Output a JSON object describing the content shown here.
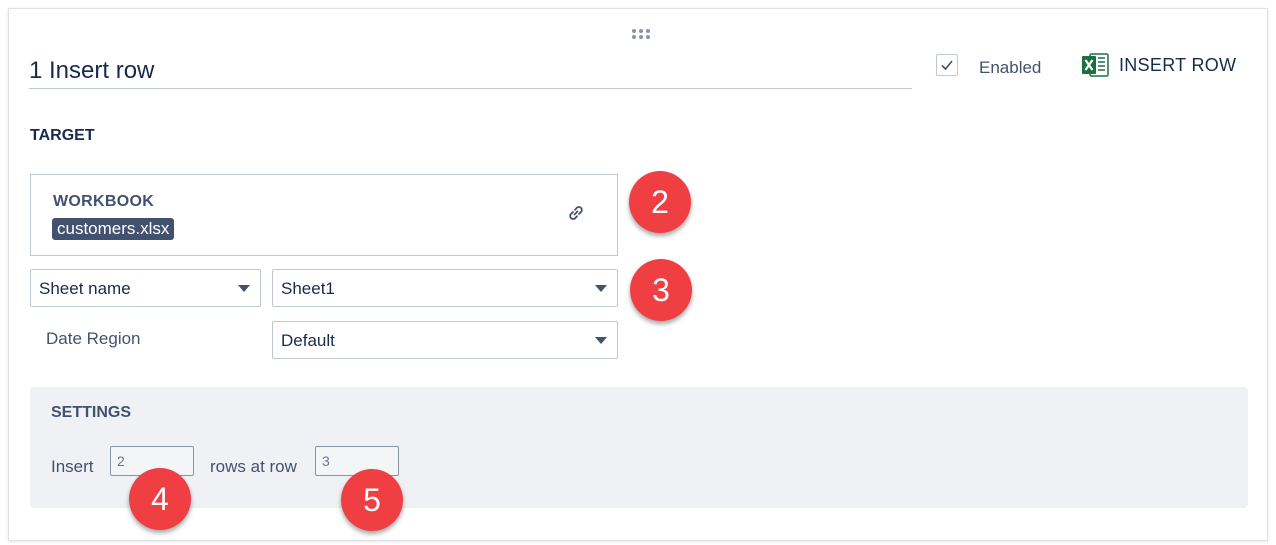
{
  "header": {
    "title_value": "1 Insert row",
    "enabled_label": "Enabled",
    "enabled_checked": true,
    "action_label": "INSERT ROW",
    "action_icon": "excel-icon",
    "drag_icon": "drag-dots-icon"
  },
  "target": {
    "section_title": "TARGET",
    "workbook": {
      "label": "WORKBOOK",
      "file_name": "customers.xlsx",
      "link_icon": "link-icon"
    },
    "sheet_selector": {
      "selected": "Sheet name"
    },
    "sheet_value": {
      "selected": "Sheet1"
    },
    "date_region": {
      "label": "Date Region",
      "selected": "Default"
    }
  },
  "settings": {
    "section_title": "SETTINGS",
    "insert_label": "Insert",
    "rows_count_value": "2",
    "rows_at_label": "rows at row",
    "row_index_value": "3"
  },
  "annotations": {
    "marker_2": "2",
    "marker_3": "3",
    "marker_4": "4",
    "marker_5": "5"
  },
  "colors": {
    "marker": "#ef3f43",
    "file_pill": "#42526e",
    "settings_bg": "#f0f1f4",
    "excel_green": "#1d6f42"
  }
}
